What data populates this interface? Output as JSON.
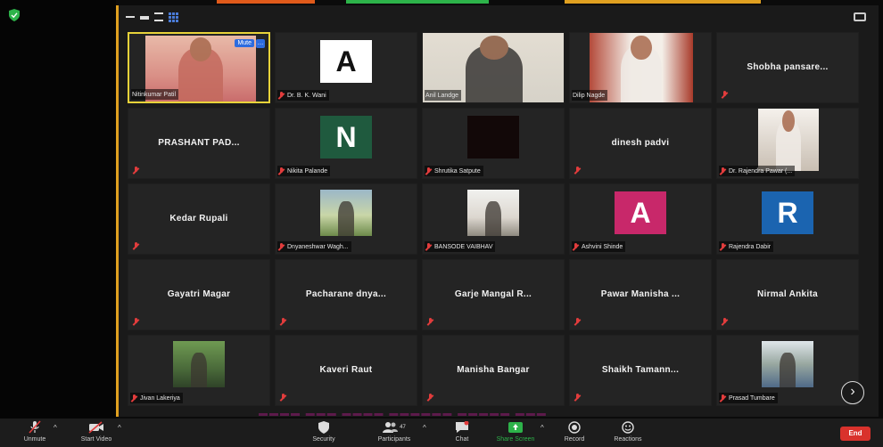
{
  "meeting": {
    "mute_label": "Mute",
    "participants": [
      {
        "name": "Nitinkumar Patil",
        "kind": "video",
        "active": true,
        "show_label": true
      },
      {
        "name": "Dr. B. K. Wani",
        "kind": "letter",
        "letter": "A",
        "letter_bg": "#ffffff",
        "letter_color": "#111111",
        "show_label": true
      },
      {
        "name": "Anil Landge",
        "kind": "video",
        "show_label": true
      },
      {
        "name": "Dilip Nagde",
        "kind": "video",
        "show_label": true
      },
      {
        "name": "Shobha pansare...",
        "kind": "name",
        "show_label": false
      },
      {
        "name": "PRASHANT PAD...",
        "kind": "name",
        "show_label": false
      },
      {
        "name": "Nikita Palande",
        "kind": "letter",
        "letter": "N",
        "letter_bg": "#1f5a3e",
        "letter_color": "#ffffff",
        "show_label": true
      },
      {
        "name": "Shrutika Satpute",
        "kind": "blank",
        "show_label": true
      },
      {
        "name": "dinesh padvi",
        "kind": "name",
        "show_label": false
      },
      {
        "name": "Dr. Rajendra Pawar (...",
        "kind": "video",
        "show_label": true
      },
      {
        "name": "Kedar Rupali",
        "kind": "name",
        "show_label": false
      },
      {
        "name": "Dnyaneshwar Wagh...",
        "kind": "photo",
        "show_label": true
      },
      {
        "name": "BANSODE VAIBHAV",
        "kind": "photo",
        "show_label": true
      },
      {
        "name": "Ashvini Shinde",
        "kind": "letter",
        "letter": "A",
        "letter_bg": "#c8286a",
        "letter_color": "#ffffff",
        "show_label": true
      },
      {
        "name": "Rajendra Dabir",
        "kind": "letter",
        "letter": "R",
        "letter_bg": "#1b64b0",
        "letter_color": "#ffffff",
        "show_label": true
      },
      {
        "name": "Gayatri Magar",
        "kind": "name",
        "show_label": false
      },
      {
        "name": "Pacharane dnya...",
        "kind": "name",
        "show_label": false
      },
      {
        "name": "Garje Mangal R...",
        "kind": "name",
        "show_label": false
      },
      {
        "name": "Pawar Manisha ...",
        "kind": "name",
        "show_label": false
      },
      {
        "name": "Nirmal Ankita",
        "kind": "name",
        "show_label": false
      },
      {
        "name": "Jivan Lakeriya",
        "kind": "photo",
        "show_label": true
      },
      {
        "name": "Kaveri Raut",
        "kind": "name",
        "show_label": false
      },
      {
        "name": "Manisha Bangar",
        "kind": "name",
        "show_label": false
      },
      {
        "name": "Shaikh Tamann...",
        "kind": "name",
        "show_label": false
      },
      {
        "name": "Prasad Tumbare",
        "kind": "photo",
        "show_label": true
      }
    ]
  },
  "toolbar": {
    "unmute": "Unmute",
    "start_video": "Start Video",
    "security": "Security",
    "participants": "Participants",
    "participants_count": "47",
    "chat": "Chat",
    "share_screen": "Share Screen",
    "record": "Record",
    "reactions": "Reactions",
    "end": "End"
  },
  "colors": {
    "share_green": "#2db34a",
    "end_red": "#d9322c",
    "active_border": "#e8d33a"
  },
  "icons": {
    "next_page": "chevron-right-icon"
  }
}
